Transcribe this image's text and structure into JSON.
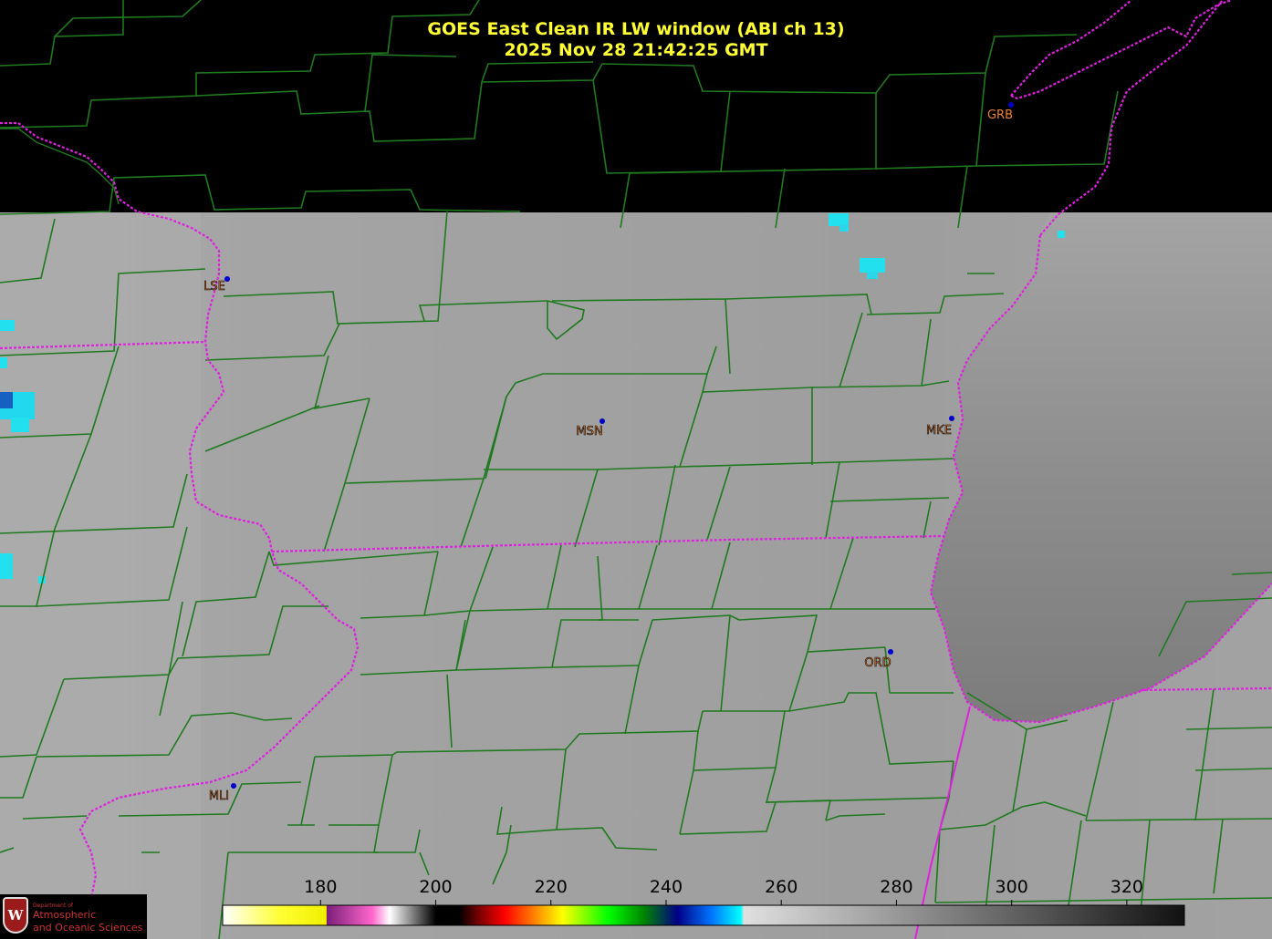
{
  "title": {
    "line1": "GOES East Clean IR LW window (ABI ch 13)",
    "line2": "2025 Nov 28  21:42:25 GMT"
  },
  "colors": {
    "background": "#000000",
    "title": "#ffff33",
    "county_lines": "#1f7a1f",
    "state_borders": "#e020e0",
    "station_dot": "#0000cc",
    "station_label": "#f08030"
  },
  "stations": [
    {
      "id": "GRB"
    },
    {
      "id": "LSE"
    },
    {
      "id": "MSN"
    },
    {
      "id": "MKE"
    },
    {
      "id": "ORD"
    },
    {
      "id": "MLI"
    }
  ],
  "colorbar": {
    "ticks": [
      "180",
      "200",
      "220",
      "240",
      "260",
      "280",
      "300",
      "320"
    ],
    "min": 163,
    "max": 330,
    "stops": [
      {
        "t": 163,
        "c": "#ffffff"
      },
      {
        "t": 173,
        "c": "#ffff33"
      },
      {
        "t": 181,
        "c": "#f0f000"
      },
      {
        "t": 181.1,
        "c": "#7a1f7a"
      },
      {
        "t": 189,
        "c": "#ff66cc"
      },
      {
        "t": 192,
        "c": "#ffffff"
      },
      {
        "t": 200,
        "c": "#000000"
      },
      {
        "t": 204,
        "c": "#000000"
      },
      {
        "t": 208,
        "c": "#880000"
      },
      {
        "t": 212,
        "c": "#ff0000"
      },
      {
        "t": 218,
        "c": "#ff9900"
      },
      {
        "t": 222,
        "c": "#ffff00"
      },
      {
        "t": 230,
        "c": "#00ff00"
      },
      {
        "t": 236,
        "c": "#008800"
      },
      {
        "t": 242,
        "c": "#000088"
      },
      {
        "t": 248,
        "c": "#0077ff"
      },
      {
        "t": 253,
        "c": "#00ffff"
      },
      {
        "t": 253.5,
        "c": "#e0e0e0"
      },
      {
        "t": 330,
        "c": "#111111"
      }
    ]
  },
  "logo": {
    "dept": "Department of",
    "line1": "Atmospheric",
    "line2": "and Oceanic Sciences",
    "seal": "W"
  }
}
